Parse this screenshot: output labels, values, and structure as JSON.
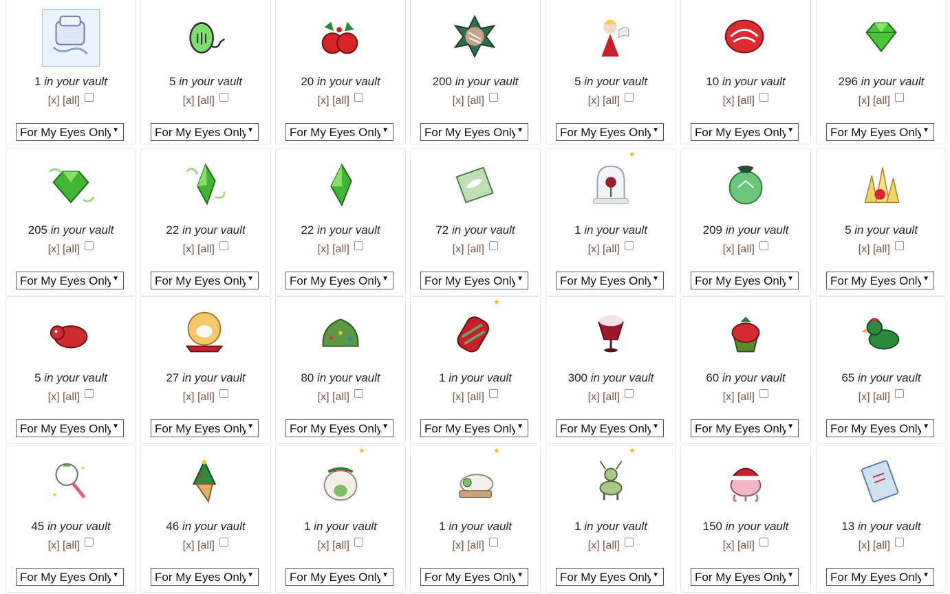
{
  "vault_label": "in your vault",
  "remove_one_label": "[x]",
  "remove_all_label": "[all]",
  "visibility_option": "For My Eyes Only",
  "items": [
    {
      "count": "1",
      "icon": "puzzle-cube-icon",
      "framed": true,
      "starred": false
    },
    {
      "count": "5",
      "icon": "green-plug-icon",
      "framed": false,
      "starred": false
    },
    {
      "count": "20",
      "icon": "holly-apples-icon",
      "framed": false,
      "starred": false
    },
    {
      "count": "200",
      "icon": "star-cookie-icon",
      "framed": false,
      "starred": false
    },
    {
      "count": "5",
      "icon": "angel-doll-icon",
      "framed": false,
      "starred": false
    },
    {
      "count": "10",
      "icon": "peppermint-candy-icon",
      "framed": false,
      "starred": false
    },
    {
      "count": "296",
      "icon": "green-gem-icon",
      "framed": false,
      "starred": false
    },
    {
      "count": "205",
      "icon": "vine-gem-icon",
      "framed": false,
      "starred": false
    },
    {
      "count": "22",
      "icon": "vine-crystal-icon",
      "framed": false,
      "starred": false
    },
    {
      "count": "22",
      "icon": "green-crystal-icon",
      "framed": false,
      "starred": false
    },
    {
      "count": "72",
      "icon": "leaf-scroll-icon",
      "framed": false,
      "starred": false
    },
    {
      "count": "1",
      "icon": "rose-bell-jar-icon",
      "framed": false,
      "starred": true
    },
    {
      "count": "209",
      "icon": "green-ornament-icon",
      "framed": false,
      "starred": false
    },
    {
      "count": "5",
      "icon": "crystal-cluster-icon",
      "framed": false,
      "starred": false
    },
    {
      "count": "5",
      "icon": "red-plush-icon",
      "framed": false,
      "starred": false
    },
    {
      "count": "27",
      "icon": "sleigh-globe-icon",
      "framed": false,
      "starred": false
    },
    {
      "count": "80",
      "icon": "cactus-lights-icon",
      "framed": false,
      "starred": false
    },
    {
      "count": "1",
      "icon": "striped-scarf-icon",
      "framed": false,
      "starred": true
    },
    {
      "count": "300",
      "icon": "cream-drink-icon",
      "framed": false,
      "starred": false
    },
    {
      "count": "60",
      "icon": "holly-cupcake-icon",
      "framed": false,
      "starred": false
    },
    {
      "count": "65",
      "icon": "green-duck-icon",
      "framed": false,
      "starred": false
    },
    {
      "count": "45",
      "icon": "unicorn-rattle-icon",
      "framed": false,
      "starred": false
    },
    {
      "count": "46",
      "icon": "tree-cone-icon",
      "framed": false,
      "starred": false
    },
    {
      "count": "1",
      "icon": "wreath-cat-icon",
      "framed": false,
      "starred": true
    },
    {
      "count": "1",
      "icon": "sleeping-cat-icon",
      "framed": false,
      "starred": true
    },
    {
      "count": "1",
      "icon": "antler-deer-icon",
      "framed": false,
      "starred": true
    },
    {
      "count": "150",
      "icon": "santa-octopus-icon",
      "framed": false,
      "starred": false
    },
    {
      "count": "13",
      "icon": "snow-notebook-icon",
      "framed": false,
      "starred": false
    }
  ]
}
